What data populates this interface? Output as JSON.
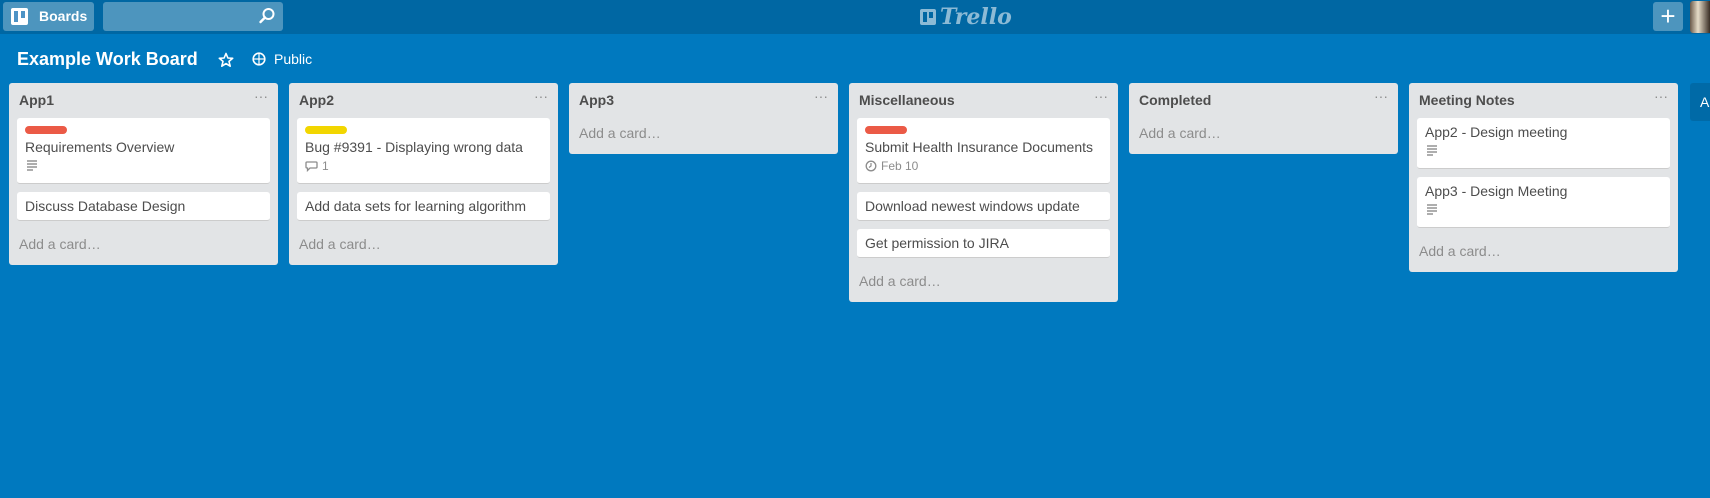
{
  "header": {
    "boards_label": "Boards",
    "search_value": "",
    "logo_text": "Trello",
    "add_label": "+"
  },
  "board": {
    "title": "Example Work Board",
    "visibility": "Public"
  },
  "lists": [
    {
      "title": "App1",
      "menu": "···",
      "add_label": "Add a card…",
      "cards": [
        {
          "title": "Requirements Overview",
          "label_color": "#eb5a46",
          "has_description": true
        },
        {
          "title": "Discuss Database Design"
        }
      ]
    },
    {
      "title": "App2",
      "menu": "···",
      "add_label": "Add a card…",
      "cards": [
        {
          "title": "Bug #9391 - Displaying wrong data",
          "label_color": "#f2d600",
          "comments": "1"
        },
        {
          "title": "Add data sets for learning algorithm"
        }
      ]
    },
    {
      "title": "App3",
      "menu": "···",
      "add_label": "Add a card…",
      "cards": []
    },
    {
      "title": "Miscellaneous",
      "menu": "···",
      "add_label": "Add a card…",
      "cards": [
        {
          "title": "Submit Health Insurance Documents",
          "label_color": "#eb5a46",
          "due": "Feb 10"
        },
        {
          "title": "Download newest windows update"
        },
        {
          "title": "Get permission to JIRA"
        }
      ]
    },
    {
      "title": "Completed",
      "menu": "···",
      "add_label": "Add a card…",
      "cards": []
    },
    {
      "title": "Meeting Notes",
      "menu": "···",
      "add_label": "Add a card…",
      "cards": [
        {
          "title": "App2 - Design meeting",
          "has_description": true
        },
        {
          "title": "App3 - Design Meeting",
          "has_description": true
        }
      ]
    }
  ],
  "next_list_label": "A",
  "icons": {
    "boards": "boards-icon",
    "search": "search-icon",
    "star": "star-icon",
    "visibility": "globe-icon",
    "description": "description-icon",
    "comment": "comment-icon",
    "due": "clock-icon"
  }
}
